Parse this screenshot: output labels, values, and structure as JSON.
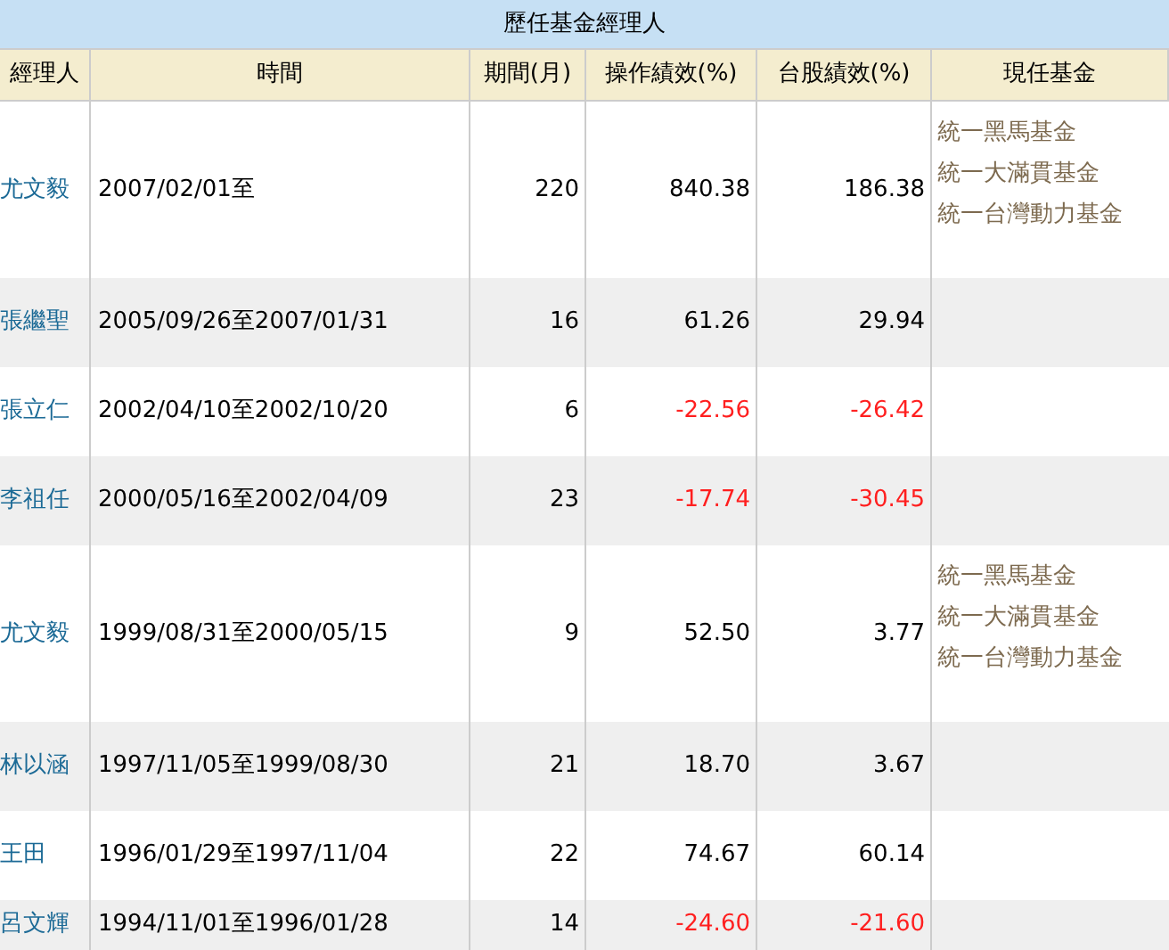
{
  "title": "歷任基金經理人",
  "columns": [
    "經理人",
    "時間",
    "期間(月)",
    "操作績效(%)",
    "台股績效(%)",
    "現任基金"
  ],
  "rows": [
    {
      "manager": "尤文毅",
      "period": "2007/02/01至",
      "months": "220",
      "performance": {
        "value": "840.38",
        "negative": false
      },
      "market": {
        "value": "186.38",
        "negative": false
      },
      "funds": [
        "統一黑馬基金",
        "統一大滿貫基金",
        "統一台灣動力基金"
      ]
    },
    {
      "manager": "張繼聖",
      "period": "2005/09/26至2007/01/31",
      "months": "16",
      "performance": {
        "value": "61.26",
        "negative": false
      },
      "market": {
        "value": "29.94",
        "negative": false
      },
      "funds": []
    },
    {
      "manager": "張立仁",
      "period": "2002/04/10至2002/10/20",
      "months": "6",
      "performance": {
        "value": "-22.56",
        "negative": true
      },
      "market": {
        "value": "-26.42",
        "negative": true
      },
      "funds": []
    },
    {
      "manager": "李祖任",
      "period": "2000/05/16至2002/04/09",
      "months": "23",
      "performance": {
        "value": "-17.74",
        "negative": true
      },
      "market": {
        "value": "-30.45",
        "negative": true
      },
      "funds": []
    },
    {
      "manager": "尤文毅",
      "period": "1999/08/31至2000/05/15",
      "months": "9",
      "performance": {
        "value": "52.50",
        "negative": false
      },
      "market": {
        "value": "3.77",
        "negative": false
      },
      "funds": [
        "統一黑馬基金",
        "統一大滿貫基金",
        "統一台灣動力基金"
      ]
    },
    {
      "manager": "林以涵",
      "period": "1997/11/05至1999/08/30",
      "months": "21",
      "performance": {
        "value": "18.70",
        "negative": false
      },
      "market": {
        "value": "3.67",
        "negative": false
      },
      "funds": []
    },
    {
      "manager": "王田",
      "period": "1996/01/29至1997/11/04",
      "months": "22",
      "performance": {
        "value": "74.67",
        "negative": false
      },
      "market": {
        "value": "60.14",
        "negative": false
      },
      "funds": []
    },
    {
      "manager": "呂文輝",
      "period": "1994/11/01至1996/01/28",
      "months": "14",
      "performance": {
        "value": "-24.60",
        "negative": true
      },
      "market": {
        "value": "-21.60",
        "negative": true
      },
      "funds": []
    }
  ]
}
